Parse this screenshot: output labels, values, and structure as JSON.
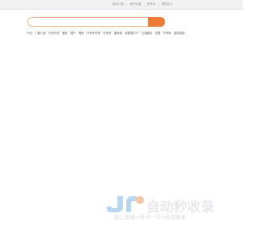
{
  "top_links": [
    "我的订单",
    "我的收藏",
    "我有车",
    "帮助中心"
  ],
  "search": {
    "value": "",
    "placeholder": ""
  },
  "nav_links": [
    "外包",
    "门窗门窗",
    "外贸外贸",
    "搬家",
    "嫂子",
    "置家",
    "外贸外贸贸",
    "外贸贸",
    "搬家搬",
    "新数据中子",
    "日语翻译",
    "设置",
    "外贸家",
    "建材装修"
  ],
  "brand": {
    "name": "自动秒收录",
    "slogan": "放上链接→来访一次→自动收录",
    "colors": {
      "mark_blue": "#b9d6f0",
      "mark_orange": "#f4c6a2",
      "text": "#e8e8ee"
    }
  },
  "colors": {
    "accent": "#ee7a33",
    "input_border": "#f0b48a"
  }
}
